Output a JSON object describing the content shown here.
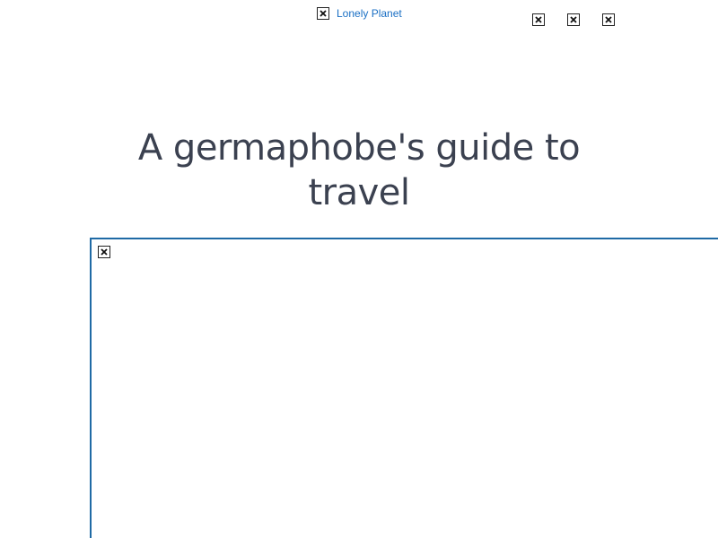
{
  "colors": {
    "link": "#1a6fc4",
    "title": "#3b4150",
    "frame_border": "#1f6aa5"
  },
  "header": {
    "logo": {
      "icon": "broken-image-icon",
      "label": "Lonely Planet"
    },
    "icons": [
      "broken-image-icon",
      "broken-image-icon",
      "broken-image-icon"
    ]
  },
  "article": {
    "title": "A germaphobe's guide to travel",
    "hero_image_icon": "broken-image-icon"
  }
}
